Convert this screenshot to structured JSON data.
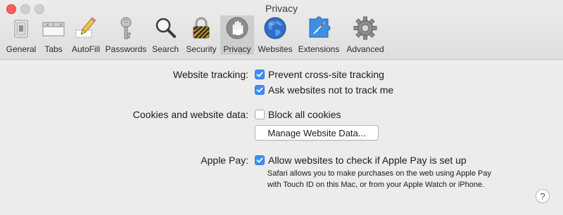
{
  "window": {
    "title": "Privacy"
  },
  "toolbar": {
    "tabs": [
      {
        "label": "General",
        "icon": "general-switch-icon"
      },
      {
        "label": "Tabs",
        "icon": "tabs-icon"
      },
      {
        "label": "AutoFill",
        "icon": "pencil-form-icon"
      },
      {
        "label": "Passwords",
        "icon": "key-icon"
      },
      {
        "label": "Search",
        "icon": "magnifier-icon"
      },
      {
        "label": "Security",
        "icon": "padlock-icon"
      },
      {
        "label": "Privacy",
        "icon": "raised-hand-icon",
        "selected": true
      },
      {
        "label": "Websites",
        "icon": "globe-icon"
      },
      {
        "label": "Extensions",
        "icon": "compass-puzzle-icon"
      },
      {
        "label": "Advanced",
        "icon": "gear-icon"
      }
    ]
  },
  "tracking": {
    "label": "Website tracking:",
    "prevent_cross_site": {
      "label": "Prevent cross-site tracking",
      "checked": true
    },
    "ask_not_track": {
      "label": "Ask websites not to track me",
      "checked": true
    }
  },
  "cookies": {
    "label": "Cookies and website data:",
    "block_all": {
      "label": "Block all cookies",
      "checked": false
    },
    "manage_button": "Manage Website Data..."
  },
  "apple_pay": {
    "label": "Apple Pay:",
    "allow_check": {
      "label": "Allow websites to check if Apple Pay is set up",
      "checked": true
    },
    "note": "Safari allows you to make purchases on the web using Apple Pay with Touch ID on this Mac, or from your Apple Watch or iPhone."
  },
  "help": {
    "label": "?"
  },
  "colors": {
    "accent": "#3d8ef7",
    "close_button": "#fc5f57",
    "window_bg": "#ececec",
    "selected_tab_bg": "#cdcdcd"
  }
}
